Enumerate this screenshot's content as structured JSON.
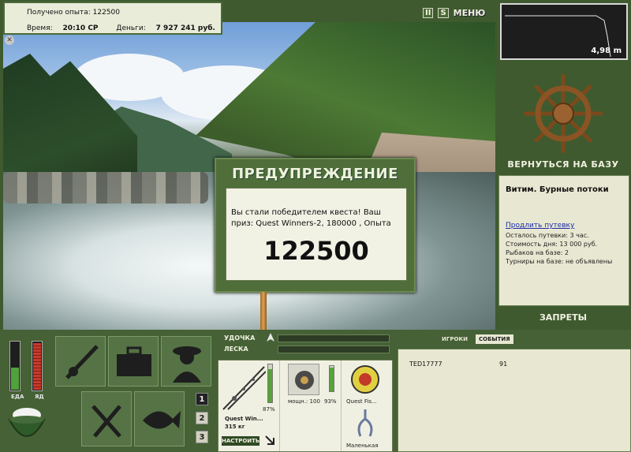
{
  "info": {
    "exp_label": "Получено опыта:",
    "exp_value": "122500",
    "time_label": "Время:",
    "time_value": "20:10 СР",
    "money_label": "Деньги:",
    "money_value": "7 927 241 руб."
  },
  "top_buttons": {
    "pause": "II",
    "sound": "S",
    "menu": "МЕНЮ"
  },
  "depth": {
    "value": "4,98 m"
  },
  "base": {
    "return_label": "ВЕРНУТЬСЯ НА БАЗУ",
    "title": "Витим. Бурные потоки",
    "extend_link": "Продлить путевку",
    "lines": [
      "Осталось путевки: 3 час.",
      "Стоимость дня: 13 000 руб.",
      "Рыбаков на базе: 2",
      "Турниры на базе: не объявлены"
    ],
    "bans_label": "ЗАПРЕТЫ"
  },
  "dialog": {
    "title": "ПРЕДУПРЕЖДЕНИЕ",
    "message": "Вы стали победителем квеста! Ваш приз: Quest Winners-2, 180000 , Опыта",
    "big_number": "122500"
  },
  "status_bars": {
    "food_label": "ЕДА",
    "poison_label": "ЯД",
    "food_level": 0.45,
    "poison_level": 0.95
  },
  "numpad": [
    "1",
    "2",
    "3"
  ],
  "rod": {
    "rod_label": "УДОЧКА",
    "line_label": "ЛЕСКА",
    "rod_name": "Quest Win...",
    "rod_weight": "315 кг",
    "rod_percent": "87%",
    "rod_level": 0.87,
    "reel_info": "мощн.: 100",
    "reel_percent": "93%",
    "reel_level": 0.93,
    "line_name": "Quest Fis...",
    "lure_name": "Маленькая",
    "setup_button": "НАСТРОИТЬ"
  },
  "events": {
    "tab_players": "ИГРОКИ",
    "tab_events": "СОБЫТИЯ",
    "rows": [
      {
        "name": "TED17777",
        "value": "91"
      }
    ]
  },
  "colors": {
    "panel_green": "#456135",
    "paper": "#e8e8d2",
    "link_blue": "#1a2ca8"
  }
}
